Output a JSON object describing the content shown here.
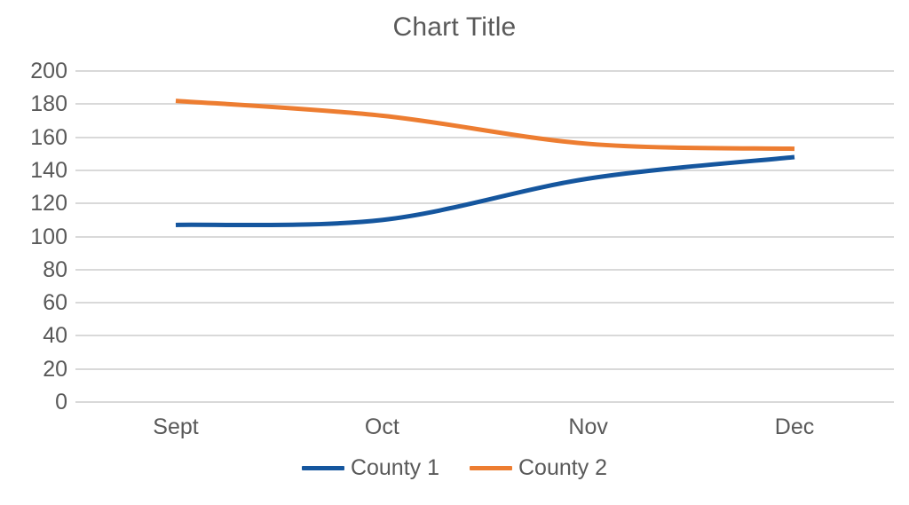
{
  "chart_data": {
    "type": "line",
    "title": "Chart Title",
    "xlabel": "",
    "ylabel": "",
    "categories": [
      "Sept",
      "Oct",
      "Nov",
      "Dec"
    ],
    "series": [
      {
        "name": "County 1",
        "color": "#15569E",
        "values": [
          107,
          110,
          135,
          148
        ]
      },
      {
        "name": "County 2",
        "color": "#ED7D31",
        "values": [
          182,
          173,
          156,
          153
        ]
      }
    ],
    "ylim": [
      0,
      200
    ],
    "yticks": [
      200,
      180,
      160,
      140,
      120,
      100,
      80,
      60,
      40,
      20,
      0
    ],
    "ytick_labels": [
      "200",
      "180",
      "160",
      "140",
      "120",
      "100",
      "80",
      "60",
      "40",
      "20",
      "0"
    ],
    "grid": true,
    "grid_color": "#D9D9D9",
    "legend_position": "bottom",
    "smoothed": true,
    "text_color": "#595959",
    "background": "#FFFFFF"
  },
  "legend": {
    "items": [
      {
        "label": "County 1",
        "color": "#15569E"
      },
      {
        "label": "County 2",
        "color": "#ED7D31"
      }
    ]
  }
}
